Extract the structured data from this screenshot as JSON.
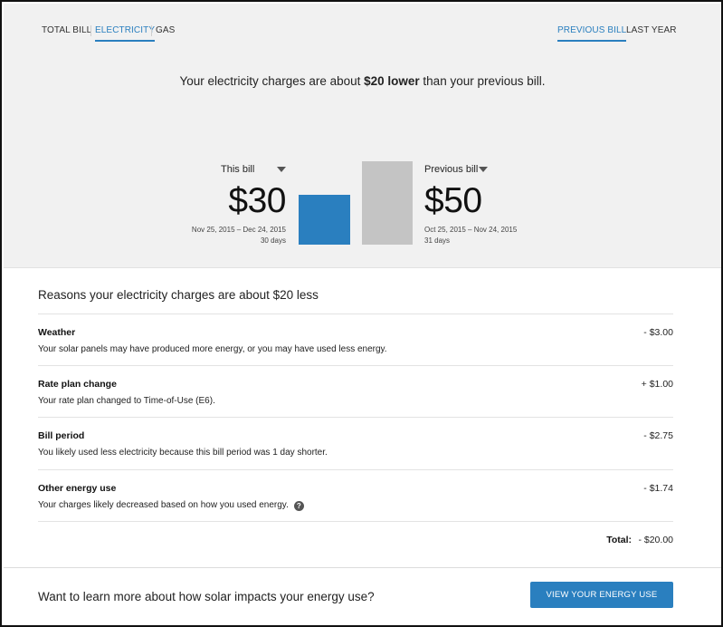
{
  "tabs": {
    "left": [
      {
        "label": "TOTAL BILL",
        "active": false
      },
      {
        "label": "ELECTRICITY",
        "active": true
      },
      {
        "label": "GAS",
        "active": false
      }
    ],
    "right": [
      {
        "label": "PREVIOUS BILL",
        "active": true
      },
      {
        "label": "LAST YEAR",
        "active": false
      }
    ]
  },
  "headline": {
    "before": "Your electricity charges are about ",
    "emphasis": "$20 lower",
    "after": " than your previous bill."
  },
  "comparison": {
    "this_bill": {
      "label": "This bill",
      "amount": "$30",
      "value": 30,
      "dates": "Nov 25, 2015 – Dec 24, 2015",
      "days": "30 days",
      "color": "#2a7fbf"
    },
    "previous_bill": {
      "label": "Previous bill",
      "amount": "$50",
      "value": 50,
      "dates": "Oct 25, 2015 – Nov 24, 2015",
      "days": "31 days",
      "color": "#c4c4c4"
    },
    "icons": {
      "dropdown": "caret-down-icon"
    }
  },
  "reasons": {
    "title": "Reasons your electricity charges are about $20 less",
    "items": [
      {
        "title": "Weather",
        "description": "Your solar panels may have produced more energy, or you may have used less energy.",
        "amount": "- $3.00"
      },
      {
        "title": "Rate plan change",
        "description": "Your rate plan changed to Time-of-Use (E6).",
        "amount": "+ $1.00"
      },
      {
        "title": "Bill period",
        "description": "You likely used less electricity because this bill period was 1 day shorter.",
        "amount": "- $2.75"
      },
      {
        "title": "Other energy use",
        "description": "Your charges likely decreased based on how you used energy.",
        "amount": "- $1.74",
        "help_icon": "?"
      }
    ],
    "total_label": "Total:",
    "total_amount": "- $20.00"
  },
  "footer": {
    "text": "Want to learn more about how solar impacts your energy use?",
    "button_label": "VIEW YOUR ENERGY USE"
  },
  "colors": {
    "accent": "#2a7fbf",
    "panel_bg": "#f1f1f1",
    "previous_bar": "#c4c4c4"
  }
}
